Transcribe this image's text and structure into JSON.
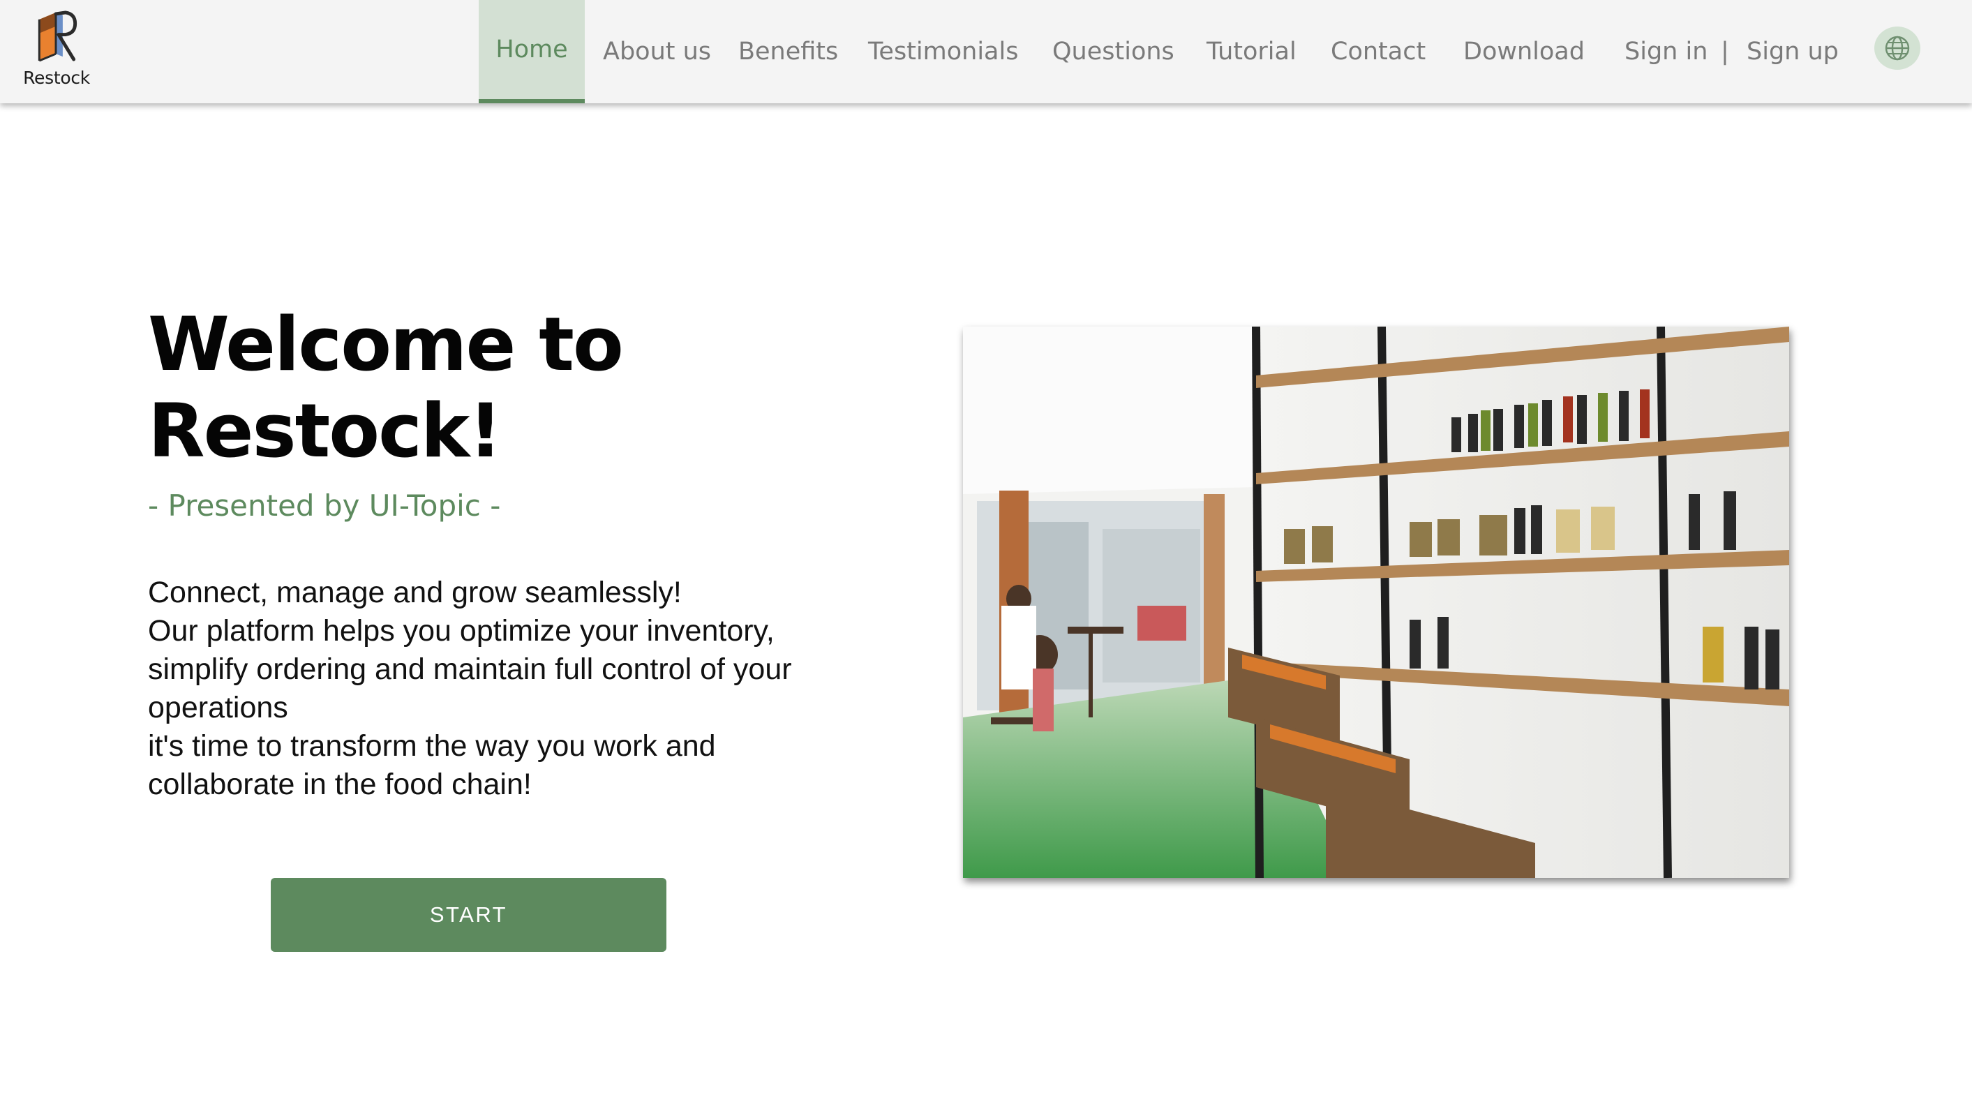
{
  "app": {
    "logo_text": "Restock",
    "logo_icon": "restock-r-box-logo"
  },
  "nav": {
    "items": [
      {
        "label": "Home",
        "active": true
      },
      {
        "label": "About us",
        "active": false
      },
      {
        "label": "Benefits",
        "active": false
      },
      {
        "label": "Testimonials",
        "active": false
      },
      {
        "label": "Questions",
        "active": false
      },
      {
        "label": "Tutorial",
        "active": false
      },
      {
        "label": "Contact",
        "active": false
      },
      {
        "label": "Download",
        "active": false
      }
    ],
    "sign_in": "Sign in",
    "separator": "|",
    "sign_up": "Sign up",
    "language_icon": "globe-icon"
  },
  "hero": {
    "title_line1": "Welcome to",
    "title_line2": "Restock!",
    "subtitle": "- Presented by UI-Topic -",
    "description": [
      "Connect, manage and grow seamlessly!",
      "Our platform helps you optimize your inventory,",
      "simplify ordering and maintain full control of your",
      "operations",
      "it's time to transform the way you work and",
      "collaborate in the food chain!"
    ],
    "start_button": "START"
  },
  "colors": {
    "accent": "#5d8a5e",
    "nav_active_bg": "#d3e0d3",
    "nav_bg": "#f4f4f4",
    "nav_text": "#7a7a7a"
  }
}
